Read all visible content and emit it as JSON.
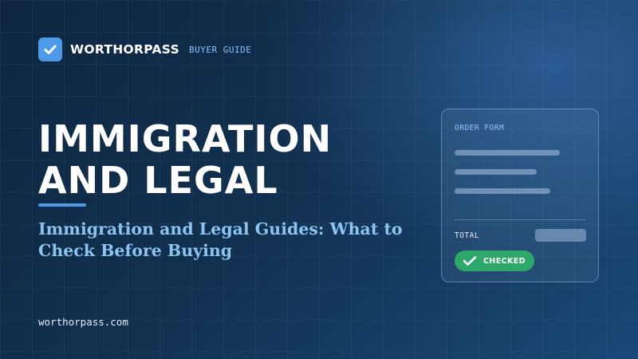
{
  "brand": {
    "name": "WORTHORPASS",
    "tag": "BUYER GUIDE",
    "logo_icon": "checkmark-icon",
    "accent_color": "#4d9be8"
  },
  "hero": {
    "title": "IMMIGRATION AND LEGAL",
    "subtitle": "Immigration and Legal Guides: What to Check Before Buying"
  },
  "footer": {
    "domain": "worthorpass.com"
  },
  "order_card": {
    "title": "ORDER FORM",
    "total_label": "TOTAL",
    "status": {
      "label": "CHECKED",
      "icon": "checkmark-icon",
      "color": "#2ea86a"
    }
  }
}
